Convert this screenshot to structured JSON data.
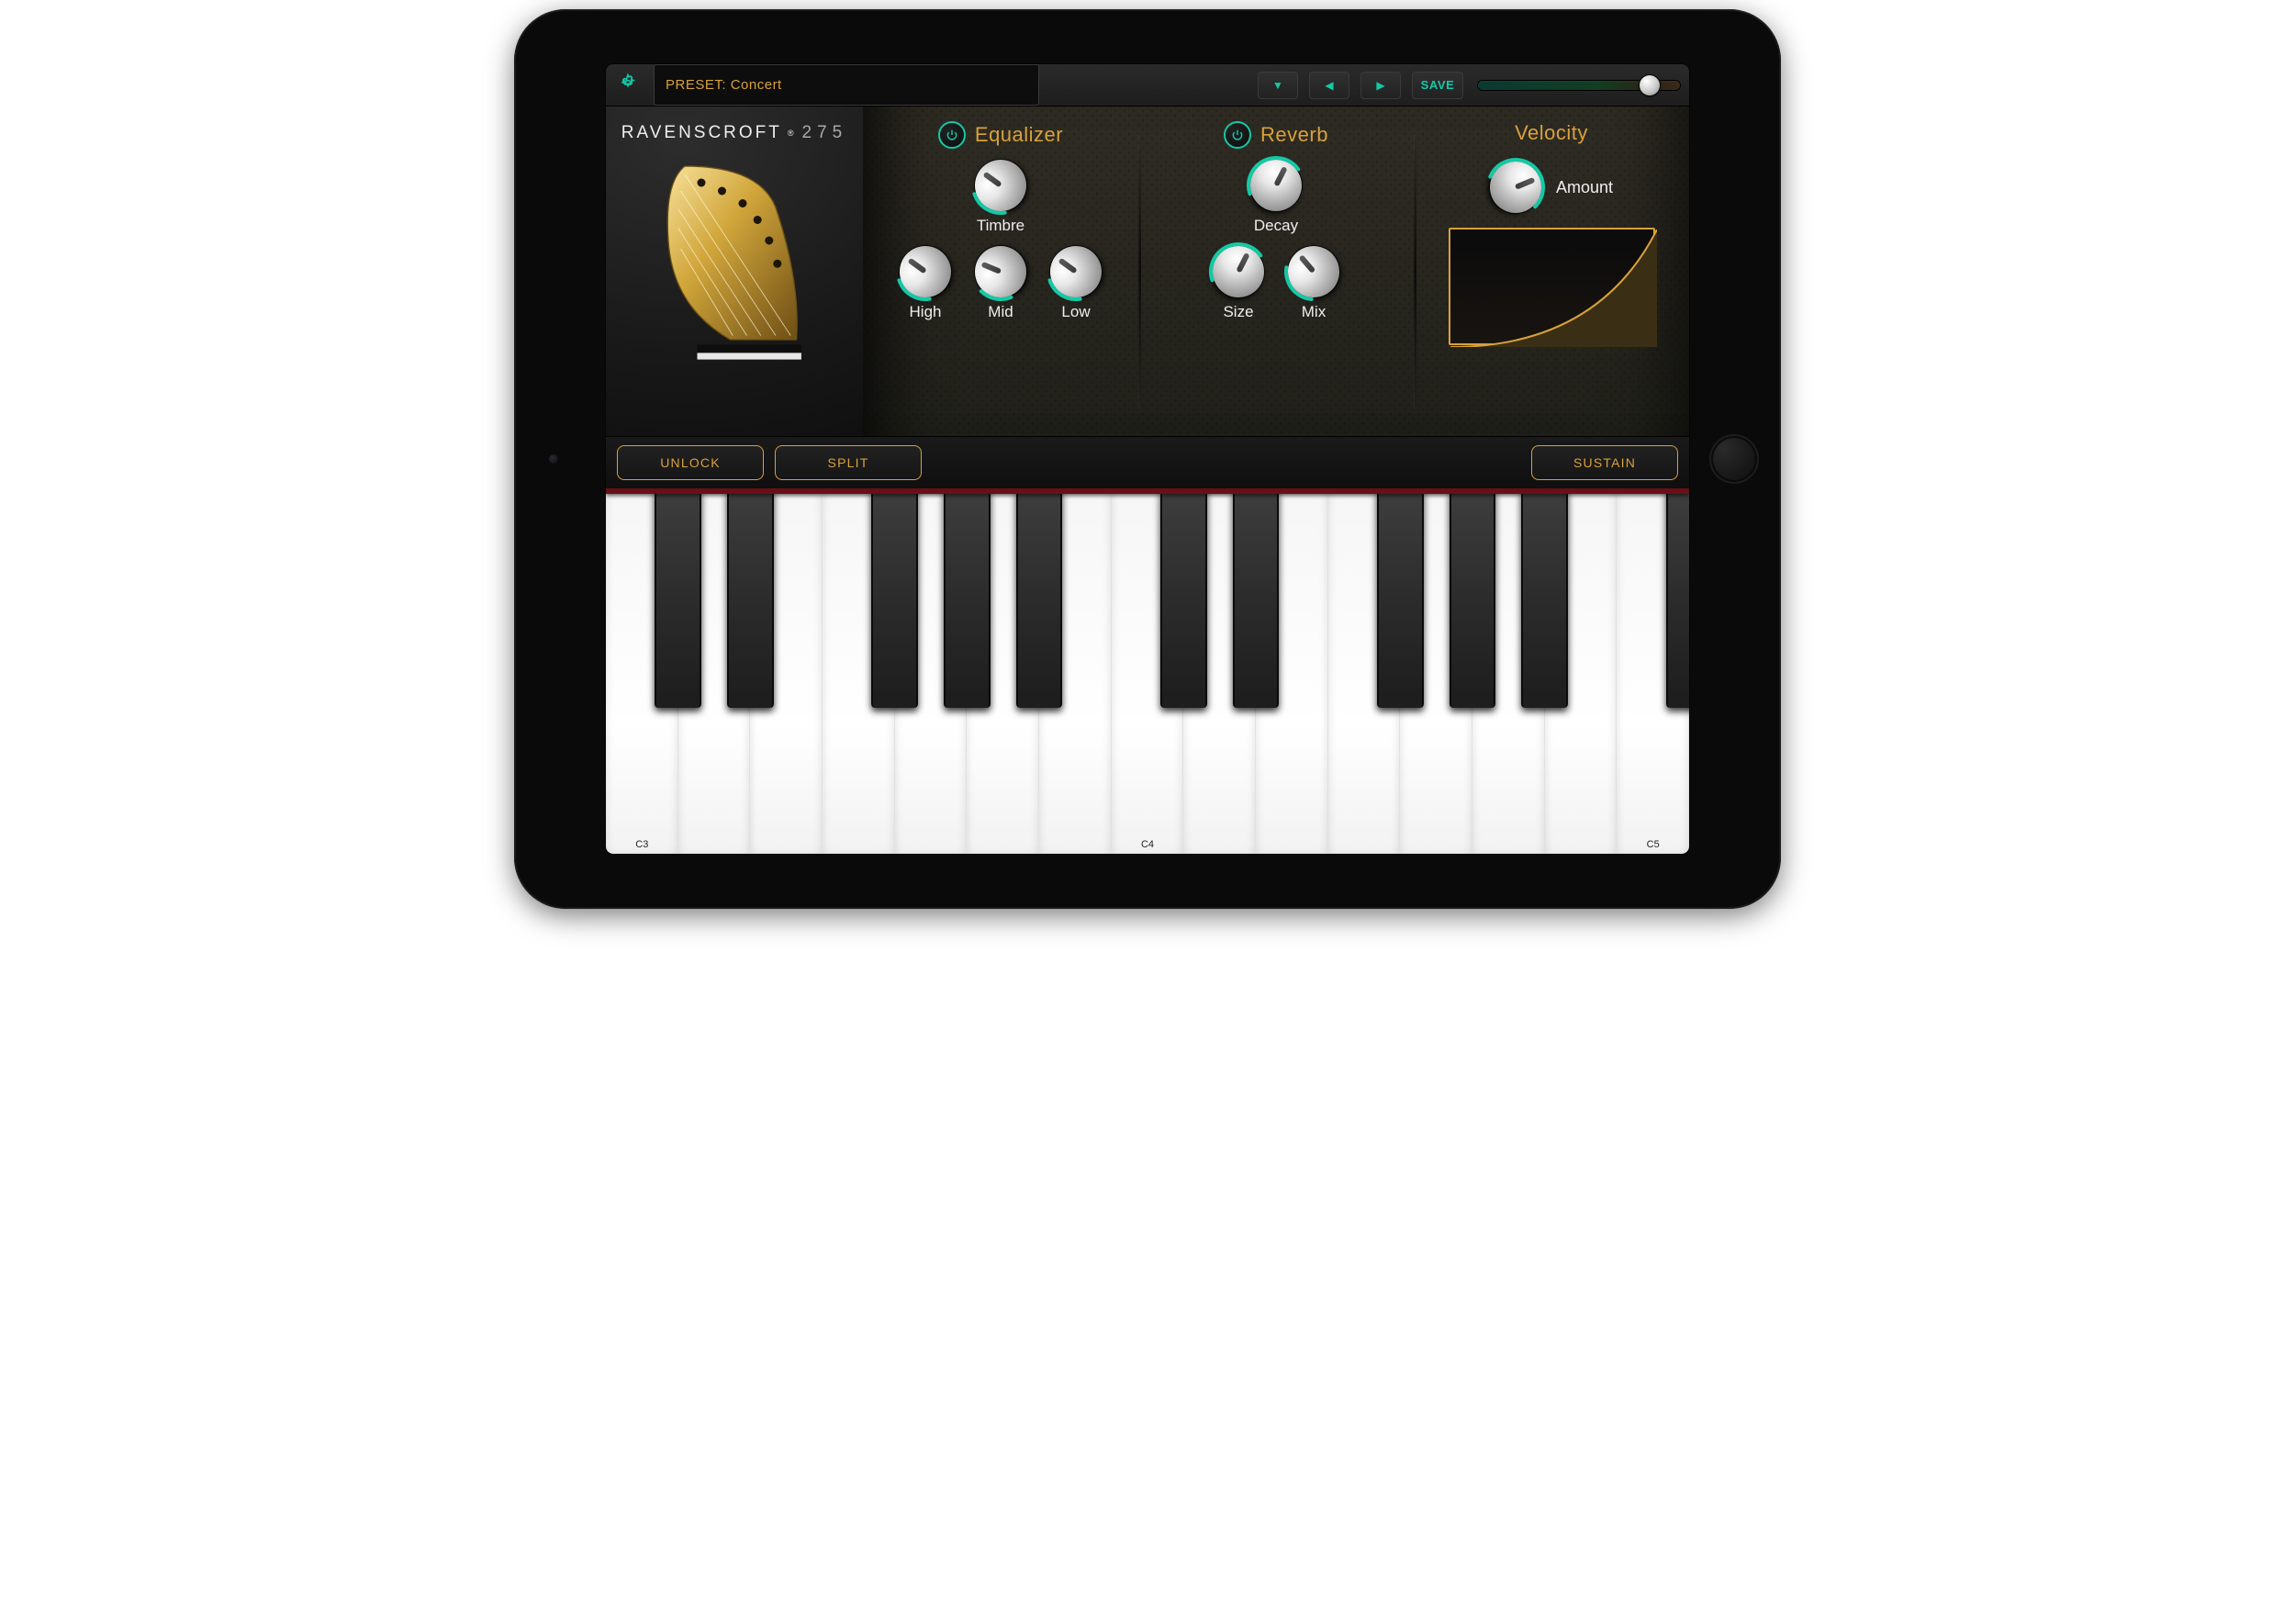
{
  "brand": {
    "name": "RAVENSCROFT",
    "model": "275"
  },
  "colors": {
    "accent_teal": "#13c9a6",
    "accent_amber": "#d9a13b"
  },
  "toolbar": {
    "preset_prefix": "PRESET:",
    "preset_name": "Concert",
    "save_label": "SAVE",
    "volume": 0.92
  },
  "sections": {
    "equalizer": {
      "title": "Equalizer",
      "power_on": true,
      "knobs": [
        {
          "id": "timbre",
          "label": "Timbre",
          "value": 0.3
        },
        {
          "id": "high",
          "label": "High",
          "value": 0.3
        },
        {
          "id": "mid",
          "label": "Mid",
          "value": 0.25
        },
        {
          "id": "low",
          "label": "Low",
          "value": 0.3
        }
      ]
    },
    "reverb": {
      "title": "Reverb",
      "power_on": true,
      "knobs": [
        {
          "id": "decay",
          "label": "Decay",
          "value": 0.6
        },
        {
          "id": "size",
          "label": "Size",
          "value": 0.6
        },
        {
          "id": "mix",
          "label": "Mix",
          "value": 0.35
        }
      ]
    },
    "velocity": {
      "title": "Velocity",
      "amount_label": "Amount",
      "amount_value": 0.75
    }
  },
  "buttons": {
    "unlock": "UNLOCK",
    "split": "SPLIT",
    "sustain": "SUSTAIN"
  },
  "keyboard": {
    "white_keys_visible": 15,
    "low_octave_offset_index": 0,
    "octave_labels": [
      "C3",
      "C4",
      "C5"
    ]
  }
}
